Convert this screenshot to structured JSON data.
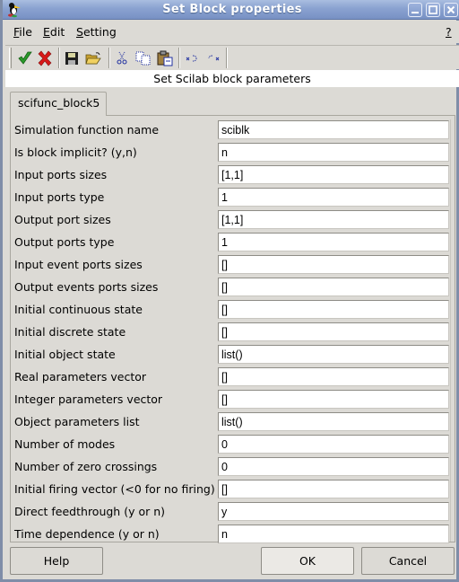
{
  "window": {
    "title": "Set Block properties",
    "controls": [
      "minimize",
      "maximize",
      "close"
    ]
  },
  "menubar": {
    "items": [
      {
        "label": "File",
        "mnemonic": "F",
        "rest": "ile"
      },
      {
        "label": "Edit",
        "mnemonic": "E",
        "rest": "dit"
      },
      {
        "label": "Setting",
        "mnemonic": "S",
        "rest": "etting"
      }
    ],
    "help": "?"
  },
  "toolbar": {
    "buttons": [
      {
        "icon": "checkmark-icon",
        "action": "ok"
      },
      {
        "icon": "cancel-x-icon",
        "action": "cancel"
      },
      {
        "icon": "save-icon",
        "action": "save"
      },
      {
        "icon": "open-folder-icon",
        "action": "open"
      },
      {
        "icon": "cut-icon",
        "action": "cut"
      },
      {
        "icon": "copy-icon",
        "action": "copy"
      },
      {
        "icon": "paste-icon",
        "action": "paste"
      },
      {
        "icon": "undo-icon",
        "action": "undo"
      },
      {
        "icon": "redo-icon",
        "action": "redo"
      }
    ]
  },
  "subtitle": "Set Scilab block parameters",
  "tab": {
    "label": "scifunc_block5"
  },
  "parameters": [
    {
      "label": "Simulation function name",
      "value": "sciblk"
    },
    {
      "label": "Is block implicit? (y,n)",
      "value": "n"
    },
    {
      "label": "Input ports sizes",
      "value": "[1,1]"
    },
    {
      "label": "Input ports type",
      "value": "1"
    },
    {
      "label": "Output port sizes",
      "value": "[1,1]"
    },
    {
      "label": "Output ports type",
      "value": "1"
    },
    {
      "label": "Input event ports sizes",
      "value": "[]"
    },
    {
      "label": "Output events ports sizes",
      "value": "[]"
    },
    {
      "label": "Initial continuous state",
      "value": "[]"
    },
    {
      "label": "Initial discrete state",
      "value": "[]"
    },
    {
      "label": "Initial object state",
      "value": "list()"
    },
    {
      "label": "Real parameters vector",
      "value": "[]"
    },
    {
      "label": "Integer parameters vector",
      "value": "[]"
    },
    {
      "label": "Object parameters list",
      "value": "list()"
    },
    {
      "label": "Number of modes",
      "value": "0"
    },
    {
      "label": "Number of zero crossings",
      "value": "0"
    },
    {
      "label": "Initial firing vector (<0 for no firing)",
      "value": "[]"
    },
    {
      "label": "Direct feedthrough (y or n)",
      "value": "y"
    },
    {
      "label": "Time dependence (y or n)",
      "value": "n"
    }
  ],
  "buttons": {
    "help": "Help",
    "ok": "OK",
    "cancel": "Cancel"
  },
  "colors": {
    "titlebar": "#8aa2d0",
    "ok_check": "#2a9a2a",
    "cancel_x": "#d81818"
  }
}
